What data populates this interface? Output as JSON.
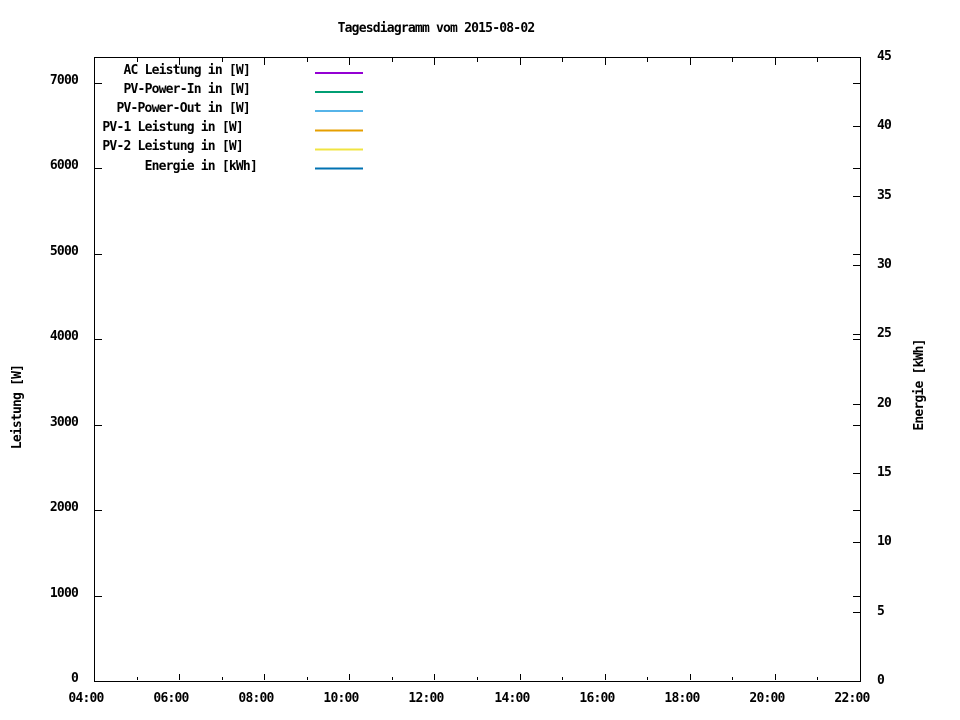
{
  "chart_data": {
    "type": "line",
    "title": "Tagesdiagramm vom 2015-08-02",
    "plot_background": "#FFFFFF",
    "grid": false,
    "x_axis": {
      "range_hours": [
        4,
        22
      ],
      "tick_labels": [
        "04:00",
        "06:00",
        "08:00",
        "10:00",
        "12:00",
        "14:00",
        "16:00",
        "18:00",
        "20:00",
        "22:00"
      ],
      "minor_tick_interval_hours": 1
    },
    "y_axis_left": {
      "label": "Leistung [W]",
      "range": [
        0,
        7300
      ],
      "ticks": [
        0,
        1000,
        2000,
        3000,
        4000,
        5000,
        6000,
        7000
      ]
    },
    "y_axis_right": {
      "label": "Energie [kWh]",
      "range": [
        0,
        45
      ],
      "ticks": [
        0,
        5,
        10,
        15,
        20,
        25,
        30,
        35,
        40,
        45
      ]
    },
    "legend": {
      "position": "top-left-inside",
      "entries": [
        {
          "label": "AC Leistung in [W]",
          "color": "#9400D3"
        },
        {
          "label": "PV-Power-In in [W]",
          "color": "#009E73"
        },
        {
          "label": "PV-Power-Out in [W]",
          "color": "#56B4E9"
        },
        {
          "label": "PV-1 Leistung in [W]",
          "color": "#E69F00"
        },
        {
          "label": "PV-2 Leistung in [W]",
          "color": "#F0E442"
        },
        {
          "label": "Energie in [kWh]",
          "color": "#0072B2"
        }
      ]
    },
    "series": [
      {
        "name": "AC Leistung in [W]",
        "color": "#9400D3",
        "points": []
      },
      {
        "name": "PV-Power-In in [W]",
        "color": "#009E73",
        "points": []
      },
      {
        "name": "PV-Power-Out in [W]",
        "color": "#56B4E9",
        "points": []
      },
      {
        "name": "PV-1 Leistung in [W]",
        "color": "#E69F00",
        "points": []
      },
      {
        "name": "PV-2 Leistung in [W]",
        "color": "#F0E442",
        "points": []
      },
      {
        "name": "Energie in [kWh]",
        "color": "#0072B2",
        "points": []
      }
    ]
  }
}
